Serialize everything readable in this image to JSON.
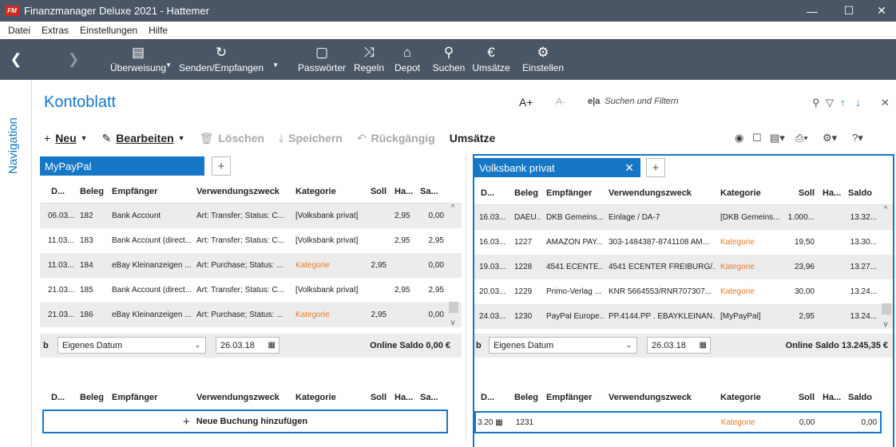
{
  "window": {
    "logo": "FM",
    "title": "Finanzmanager Deluxe 2021 - Hattemer",
    "minimize": "—",
    "maximize": "☐",
    "close": "✕"
  },
  "menu": [
    "Datei",
    "Extras",
    "Einstellungen",
    "Hilfe"
  ],
  "toolbar": {
    "back": "❮",
    "forward": "❯",
    "items": [
      {
        "label": "Überweisung",
        "icon": "transfer-icon"
      },
      {
        "label": "Senden/Empfangen",
        "icon": "sync-icon"
      },
      {
        "label": "Passwörter",
        "icon": "lock-icon"
      },
      {
        "label": "Regeln",
        "icon": "shuffle-icon"
      },
      {
        "label": "Depot",
        "icon": "bank-icon"
      },
      {
        "label": "Suchen",
        "icon": "search-icon"
      },
      {
        "label": "Umsätze",
        "icon": "euro-icon"
      },
      {
        "label": "Einstellen",
        "icon": "gear-icon"
      }
    ]
  },
  "nav": {
    "label": "Navigation"
  },
  "page": {
    "title": "Kontoblatt",
    "font_larger": "A+",
    "font_smaller": "A-",
    "search_placeholder": "Suchen und Filtern"
  },
  "actions": {
    "new": "Neu",
    "edit": "Bearbeiten",
    "delete": "Löschen",
    "save": "Speichern",
    "undo": "Rückgängig",
    "sales": "Umsätze"
  },
  "left": {
    "tab": "MyPayPal",
    "headers": [
      "D...",
      "Beleg",
      "Empfänger",
      "Verwendungszweck",
      "Kategorie",
      "Soll",
      "Ha...",
      "Sa..."
    ],
    "rows": [
      [
        "06.03...",
        "182",
        "Bank Account",
        "Art: Transfer; Status: C...",
        "[Volksbank privat]",
        "",
        "2,95",
        "0,00"
      ],
      [
        "11.03...",
        "183",
        "Bank Account (direct...",
        "Art: Transfer; Status: C...",
        "[Volksbank privat]",
        "",
        "2,95",
        "2,95"
      ],
      [
        "11.03...",
        "184",
        "eBay Kleinanzeigen ...",
        "Art: Purchase; Status: ...",
        "Kategorie",
        "2,95",
        "",
        "0,00"
      ],
      [
        "21.03...",
        "185",
        "Bank Account (direct...",
        "Art: Transfer; Status: C...",
        "[Volksbank privat]",
        "",
        "2,95",
        "2,95"
      ],
      [
        "21.03...",
        "186",
        "eBay Kleinanzeigen ...",
        "Art: Purchase; Status: ...",
        "Kategorie",
        "2,95",
        "",
        "0,00"
      ]
    ],
    "footer": {
      "b": "b",
      "date_mode": "Eigenes Datum",
      "date": "26.03.18",
      "saldo": "Online Saldo 0,00 €"
    },
    "new_headers": [
      "D...",
      "Beleg",
      "Empfänger",
      "Verwendungszweck",
      "Kategorie",
      "Soll",
      "Ha...",
      "Sa..."
    ],
    "add_button": "Neue Buchung hinzufügen"
  },
  "right": {
    "tab": "Volksbank privat",
    "headers": [
      "D...",
      "Beleg",
      "Empfänger",
      "Verwendungszweck",
      "Kategorie",
      "Soll",
      "Ha...",
      "Saldo"
    ],
    "rows": [
      [
        "16.03...",
        "DAEU...",
        "DKB Gemeins...",
        "Einlage / DA-7",
        "[DKB Gemeins...",
        "1.000...",
        "",
        "13.32..."
      ],
      [
        "16.03...",
        "1227",
        "AMAZON PAY...",
        "303-1484387-8741108 AM...",
        "Kategorie",
        "19,50",
        "",
        "13.30..."
      ],
      [
        "19.03...",
        "1228",
        "4541 ECENTE...",
        "4541 ECENTER FREIBURG/...",
        "Kategorie",
        "23,96",
        "",
        "13.27..."
      ],
      [
        "20.03...",
        "1229",
        "Primo-Verlag ...",
        "KNR 5664553/RNR707307...",
        "Kategorie",
        "30,00",
        "",
        "13.24..."
      ],
      [
        "24.03...",
        "1230",
        "PayPal Europe...",
        "PP.4144.PP . EBAYKLEINAN...",
        "[MyPayPal]",
        "2,95",
        "",
        "13.24..."
      ]
    ],
    "footer": {
      "b": "b",
      "date_mode": "Eigenes Datum",
      "date": "26.03.18",
      "saldo": "Online Saldo 13.245,35 €"
    },
    "new_headers": [
      "D...",
      "Beleg",
      "Empfänger",
      "Verwendungszweck",
      "Kategorie",
      "Soll",
      "Ha...",
      "Saldo"
    ],
    "new_row": [
      "3.20",
      "1231",
      "",
      "",
      "Kategorie",
      "0,00",
      "",
      "0,00"
    ]
  }
}
